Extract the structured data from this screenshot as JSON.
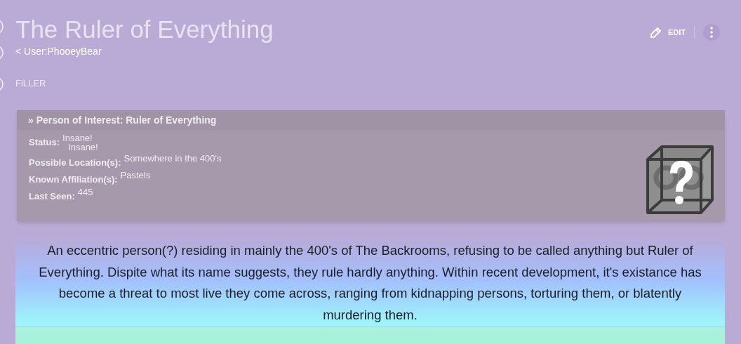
{
  "page": {
    "title": "The Ruler of Everything",
    "breadcrumb": "< User:PhooeyBear",
    "category": "FiLLER"
  },
  "actions": {
    "edit": "EDIT"
  },
  "infobox": {
    "heading": "» Person of Interest: Ruler of Everything",
    "fields": [
      {
        "label": "Status:",
        "values": [
          "Insane!",
          "Insane!"
        ]
      },
      {
        "label": "Possible Location(s):",
        "values": [
          "Somewhere in the 400's"
        ]
      },
      {
        "label": "Known Affiliation(s):",
        "values": [
          "Pastels"
        ]
      },
      {
        "label": "Last Seen:",
        "values": [
          "445"
        ]
      }
    ]
  },
  "description": "An eccentric person(?) residing in mainly the 400's of The Backrooms, refusing to be called anything but Ruler of Everything. Dispite what its name suggests, they rule hardly anything. Within recent development, it's existance has become a threat to most live they come across, ranging from kidnapping persons, torturing them, or blatently murdering them."
}
